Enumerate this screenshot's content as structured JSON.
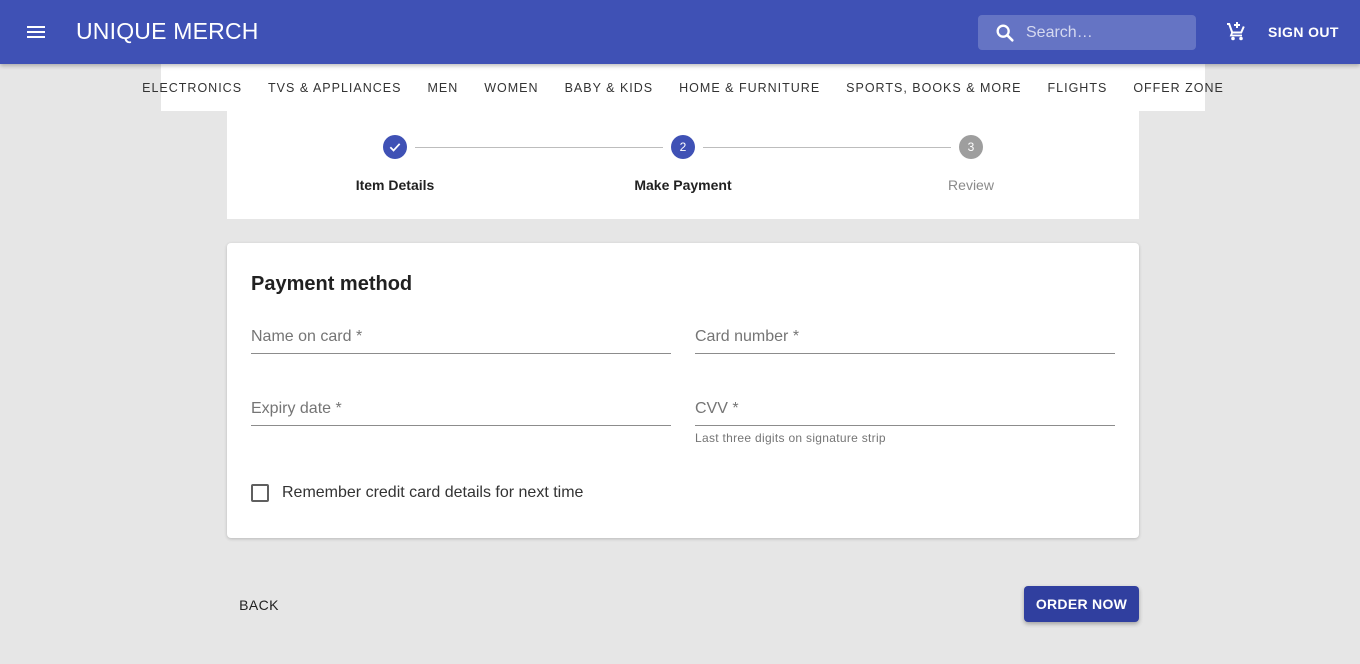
{
  "header": {
    "menu_icon": "menu-icon",
    "brand": "UNIQUE MERCH",
    "search_placeholder": "Search…",
    "search_icon": "search-icon",
    "cart_icon": "add-shopping-cart-icon",
    "sign_out_label": "SIGN OUT",
    "colors": {
      "primary": "#3f51b5",
      "search_bg": "#6574c4"
    }
  },
  "categories": [
    "ELECTRONICS",
    "TVS & APPLIANCES",
    "MEN",
    "WOMEN",
    "BABY & KIDS",
    "HOME & FURNITURE",
    "SPORTS, BOOKS & MORE",
    "FLIGHTS",
    "OFFER ZONE"
  ],
  "stepper": {
    "steps": [
      {
        "label": "Item Details",
        "number": "1",
        "state": "completed",
        "icon": "check-icon"
      },
      {
        "label": "Make Payment",
        "number": "2",
        "state": "active"
      },
      {
        "label": "Review",
        "number": "3",
        "state": "pending"
      }
    ]
  },
  "payment": {
    "title": "Payment method",
    "fields": {
      "name_on_card": {
        "placeholder": "Name on card *",
        "value": ""
      },
      "card_number": {
        "placeholder": "Card number *",
        "value": ""
      },
      "expiry_date": {
        "placeholder": "Expiry date *",
        "value": ""
      },
      "cvv": {
        "placeholder": "CVV *",
        "value": "",
        "helper": "Last three digits on signature strip"
      }
    },
    "remember_label": "Remember credit card details for next time",
    "remember_checked": false
  },
  "actions": {
    "back_label": "BACK",
    "order_label": "ORDER NOW",
    "order_color": "#303f9f"
  }
}
